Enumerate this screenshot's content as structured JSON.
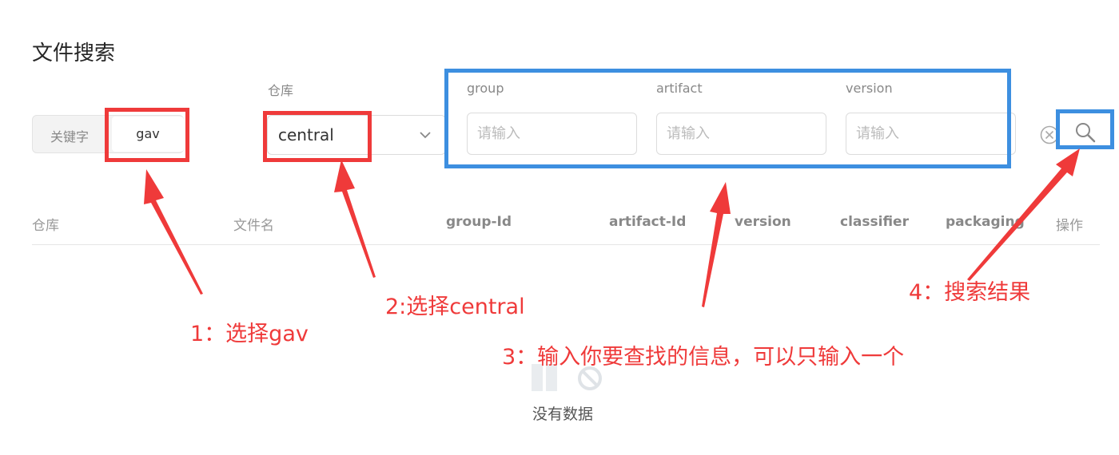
{
  "page": {
    "title": "文件搜索"
  },
  "search": {
    "mode_options": [
      "关键字",
      "gav"
    ],
    "selected_mode": "gav",
    "repo_label": "仓库",
    "repo_value": "central",
    "fields": [
      {
        "label": "group",
        "placeholder": "请输入",
        "value": ""
      },
      {
        "label": "artifact",
        "placeholder": "请输入",
        "value": ""
      },
      {
        "label": "version",
        "placeholder": "请输入",
        "value": ""
      }
    ]
  },
  "table": {
    "columns": [
      "仓库",
      "文件名",
      "group-Id",
      "artifact-Id",
      "version",
      "classifier",
      "packaging",
      "操作"
    ],
    "rows": [],
    "empty_text": "没有数据"
  },
  "annotations": [
    "1：选择gav",
    "2:选择central",
    "3：输入你要查找的信息，可以只输入一个",
    "4：搜索结果"
  ],
  "colors": {
    "annotation_red": "#ef3a3a",
    "annotation_blue": "#3d8fe0"
  }
}
